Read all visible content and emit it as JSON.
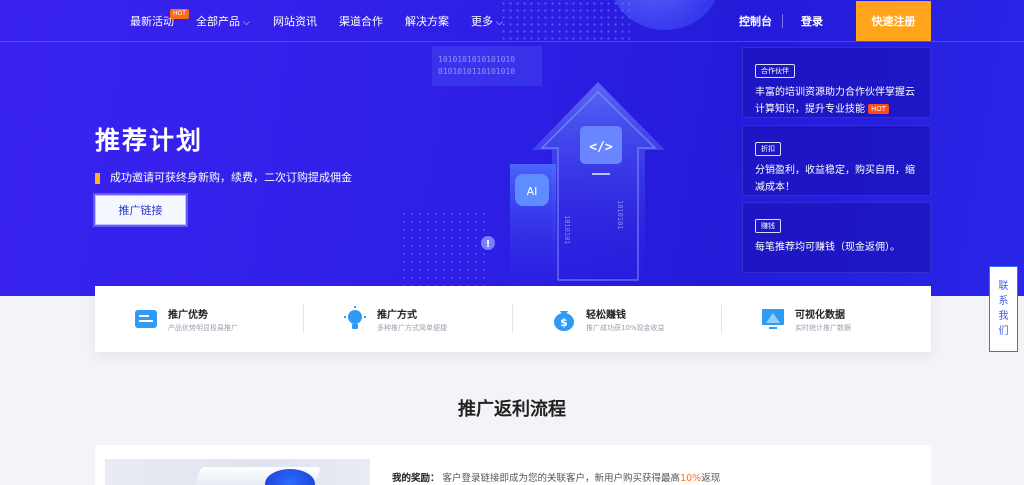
{
  "nav": {
    "items": [
      {
        "label": "最新活动",
        "badge": "HOT"
      },
      {
        "label": "全部产品",
        "chevron": true
      },
      {
        "label": "网站资讯"
      },
      {
        "label": "渠道合作"
      },
      {
        "label": "解决方案"
      },
      {
        "label": "更多",
        "chevron": true
      }
    ],
    "console": "控制台",
    "login": "登录",
    "signup": "快速注册"
  },
  "hero": {
    "title": "推荐计划",
    "subtitle": "成功邀请可获终身新购，续费，二次订购提成佣金",
    "button": "推广链接",
    "illustration": {
      "ai_label": "AI",
      "code_label": "</>"
    }
  },
  "cards": [
    {
      "tag": "合作伙伴",
      "text": "丰富的培训资源助力合作伙伴掌握云计算知识，提升专业技能",
      "badge": "HOT"
    },
    {
      "tag": "折扣",
      "text": "分销盈利，收益稳定，购买自用，缩减成本！"
    },
    {
      "tag": "赚钱",
      "text": "每笔推荐均可赚钱（现金返佣）。"
    }
  ],
  "features": [
    {
      "title": "推广优势",
      "desc": "产品优势明显极易推广",
      "icon": "card-icon"
    },
    {
      "title": "推广方式",
      "desc": "多种推广方式简单便捷",
      "icon": "bulb-icon"
    },
    {
      "title": "轻松赚钱",
      "desc": "推广成功获10%现金收益",
      "icon": "money-bag-icon"
    },
    {
      "title": "可视化数据",
      "desc": "实时统计推广数据",
      "icon": "monitor-icon"
    }
  ],
  "contact": [
    "联",
    "系",
    "我",
    "们"
  ],
  "section": {
    "title": "推广返利流程",
    "reward_label": "我的奖励：",
    "reward_text": "客户登录链接即成为您的关联客户，新用户购买获得最高",
    "reward_highlight": "10%",
    "reward_suffix": "返现"
  },
  "colors": {
    "accent": "#ffa41b",
    "hero": "#2f1fe6",
    "hot": "#ff6a1a"
  }
}
